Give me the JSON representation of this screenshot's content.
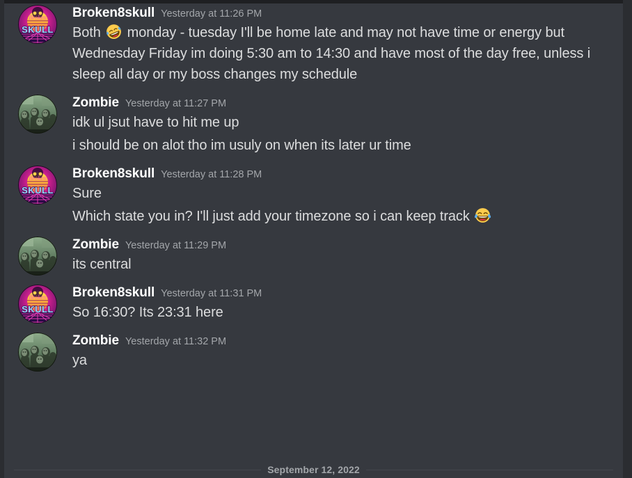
{
  "app": {
    "name": "Discord",
    "theme_colors": {
      "background": "#36393f",
      "sidebar_dark": "#2b2d31",
      "edge_dark": "#1e1f22",
      "username": "#ffffff",
      "timestamp": "#a3a6aa",
      "message_text": "#dcddde",
      "divider_rule": "#43464d"
    }
  },
  "messages": [
    {
      "author": "Broken8skull",
      "timestamp": "Yesterday at 11:26 PM",
      "avatar": "synthwave-skull-avatar",
      "lines": [
        {
          "parts": [
            {
              "type": "text",
              "value": "Both "
            },
            {
              "type": "emoji",
              "name": "rolling-on-the-floor-laughing-emoji",
              "char": "🤣"
            },
            {
              "type": "text",
              "value": " monday - tuesday I'll be home late and may not have time or energy but Wednesday Friday im doing 5:30 am to 14:30 and have most of the day free, unless i sleep all day or my boss changes my schedule"
            }
          ]
        }
      ]
    },
    {
      "author": "Zombie",
      "timestamp": "Yesterday at 11:27 PM",
      "avatar": "zombie-crowd-avatar",
      "lines": [
        {
          "parts": [
            {
              "type": "text",
              "value": "idk ul jsut have to hit me up"
            }
          ]
        },
        {
          "parts": [
            {
              "type": "text",
              "value": "i should be on alot tho im usuly on when its later ur time"
            }
          ]
        }
      ]
    },
    {
      "author": "Broken8skull",
      "timestamp": "Yesterday at 11:28 PM",
      "avatar": "synthwave-skull-avatar",
      "lines": [
        {
          "parts": [
            {
              "type": "text",
              "value": "Sure"
            }
          ]
        },
        {
          "parts": [
            {
              "type": "text",
              "value": "Which state you in? I'll just add your timezone so i can keep track "
            },
            {
              "type": "emoji",
              "name": "face-with-tears-of-joy-emoji",
              "char": "😂"
            }
          ]
        }
      ]
    },
    {
      "author": "Zombie",
      "timestamp": "Yesterday at 11:29 PM",
      "avatar": "zombie-crowd-avatar",
      "lines": [
        {
          "parts": [
            {
              "type": "text",
              "value": "its central"
            }
          ]
        }
      ]
    },
    {
      "author": "Broken8skull",
      "timestamp": "Yesterday at 11:31 PM",
      "avatar": "synthwave-skull-avatar",
      "lines": [
        {
          "parts": [
            {
              "type": "text",
              "value": "So 16:30? Its 23:31 here"
            }
          ]
        }
      ]
    },
    {
      "author": "Zombie",
      "timestamp": "Yesterday at 11:32 PM",
      "avatar": "zombie-crowd-avatar",
      "lines": [
        {
          "parts": [
            {
              "type": "text",
              "value": "ya"
            }
          ]
        }
      ]
    }
  ],
  "date_divider": {
    "label": "September 12, 2022"
  }
}
